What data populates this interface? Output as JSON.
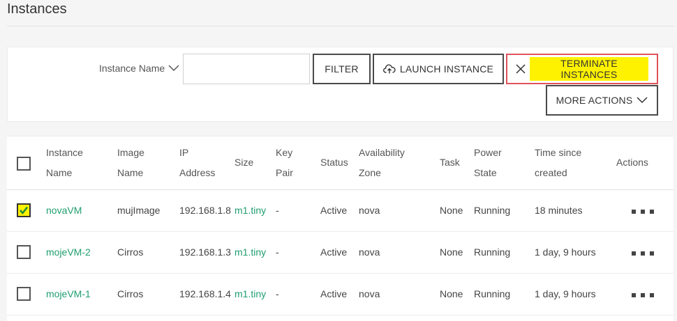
{
  "page": {
    "title": "Instances"
  },
  "toolbar": {
    "filter_field_label": "Instance Name",
    "filter_input_value": "",
    "filter_button": "FILTER",
    "launch_button": "LAUNCH INSTANCE",
    "terminate_button": "TERMINATE INSTANCES",
    "more_actions_button": "MORE ACTIONS"
  },
  "table": {
    "headers": {
      "instance_name": [
        "Instance",
        "Name"
      ],
      "image_name": [
        "Image",
        "Name"
      ],
      "ip_address": [
        "IP",
        "Address"
      ],
      "size": "Size",
      "key_pair": [
        "Key",
        "Pair"
      ],
      "status": "Status",
      "availability_zone": [
        "Availability",
        "Zone"
      ],
      "task": "Task",
      "power_state": [
        "Power",
        "State"
      ],
      "time_since_created": [
        "Time since",
        "created"
      ],
      "actions": "Actions"
    },
    "rows": [
      {
        "checked": true,
        "instance_name": "novaVM",
        "image_name": "mujImage",
        "ip_address": "192.168.1.8",
        "size": "m1.tiny",
        "key_pair": "-",
        "status": "Active",
        "availability_zone": "nova",
        "task": "None",
        "power_state": "Running",
        "time_since_created": "18 minutes"
      },
      {
        "checked": false,
        "instance_name": "mojeVM-2",
        "image_name": "Cirros",
        "ip_address": "192.168.1.3",
        "size": "m1.tiny",
        "key_pair": "-",
        "status": "Active",
        "availability_zone": "nova",
        "task": "None",
        "power_state": "Running",
        "time_since_created": "1 day, 9 hours"
      },
      {
        "checked": false,
        "instance_name": "mojeVM-1",
        "image_name": "Cirros",
        "ip_address": "192.168.1.4",
        "size": "m1.tiny",
        "key_pair": "-",
        "status": "Active",
        "availability_zone": "nova",
        "task": "None",
        "power_state": "Running",
        "time_since_created": "1 day, 9 hours"
      }
    ]
  },
  "icons": {
    "filter_dropdown": "chevron-down-icon",
    "launch": "cloud-upload-icon",
    "terminate": "close-icon",
    "more_actions": "chevron-down-icon",
    "row_actions": "more-dots-icon",
    "checkbox_checked": "checkmark-icon"
  },
  "colors": {
    "link": "#1e9e6f",
    "highlight": "#fff200",
    "terminate_border": "#e0525a"
  }
}
